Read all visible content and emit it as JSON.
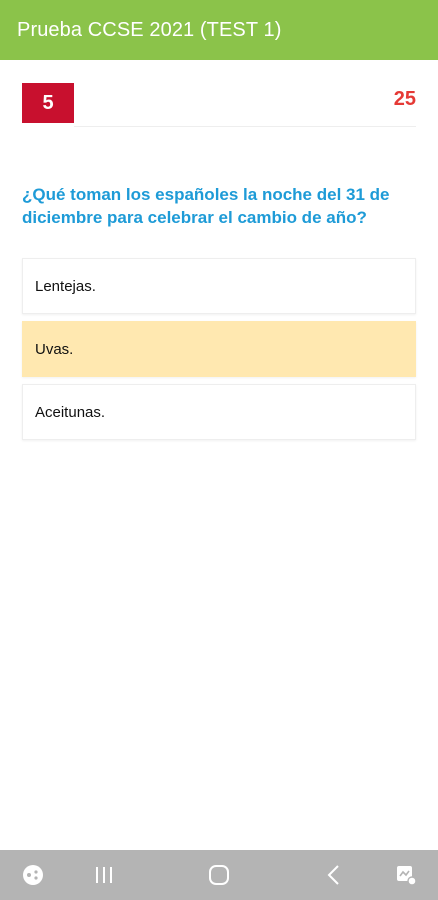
{
  "app": {
    "title": "Prueba CCSE 2021 (TEST 1)"
  },
  "question": {
    "number": "5",
    "total": "25",
    "text": "¿Qué toman los españoles la noche del 31 de diciembre para celebrar el cambio de año?"
  },
  "options": [
    {
      "label": "Lentejas.",
      "selected": false
    },
    {
      "label": "Uvas.",
      "selected": true
    },
    {
      "label": "Aceitunas.",
      "selected": false
    }
  ],
  "colors": {
    "appbar": "#8bc34a",
    "badge": "#c8102e",
    "total": "#e53935",
    "question": "#1e9bd7",
    "selected_option": "#ffe8b0",
    "navbar": "#b4b4b4"
  },
  "navbar": {
    "icons": [
      "game-icon",
      "recent-apps-icon",
      "home-icon",
      "back-icon",
      "assistant-icon"
    ]
  }
}
